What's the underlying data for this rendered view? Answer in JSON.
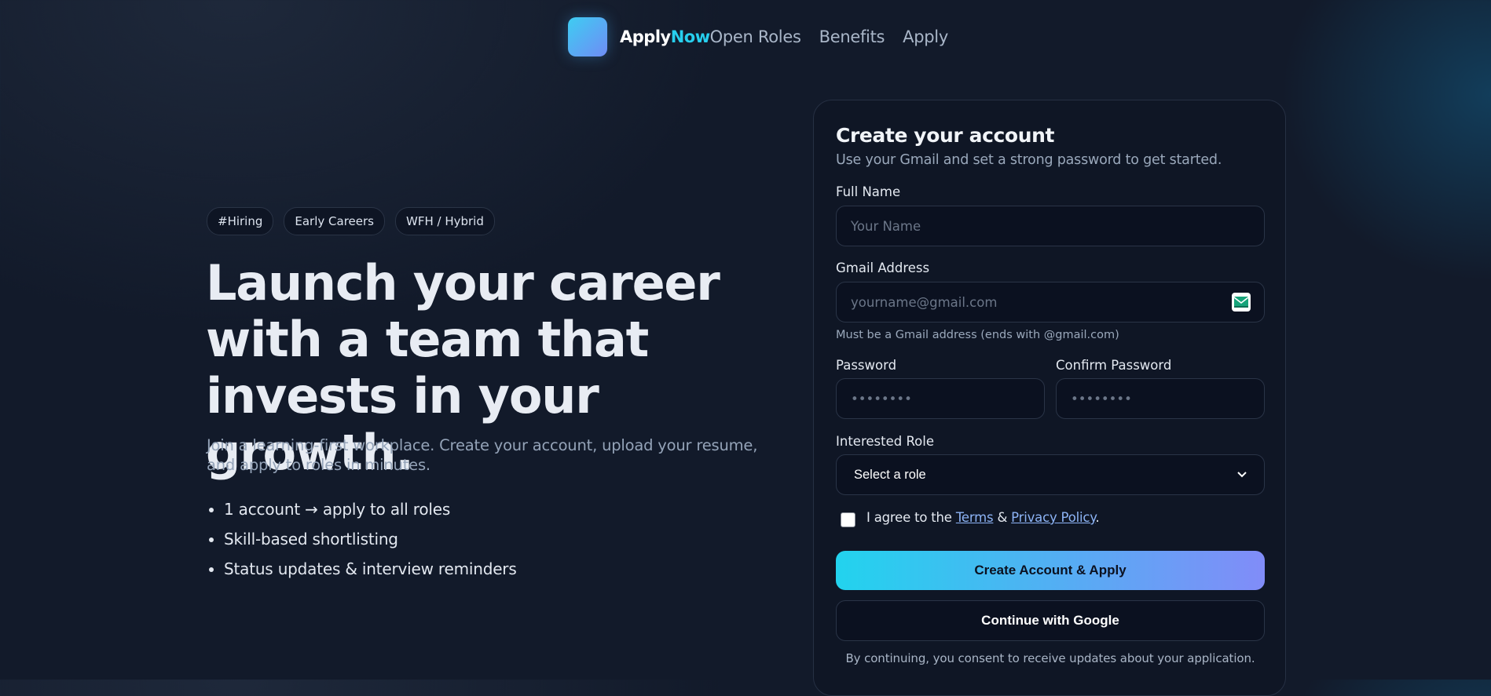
{
  "header": {
    "brand_part1": "Apply",
    "brand_part2": "Now",
    "nav": [
      "Open Roles",
      "Benefits",
      "Apply"
    ]
  },
  "hero": {
    "tags": [
      "#Hiring",
      "Early Careers",
      "WFH / Hybrid"
    ],
    "title": "Launch your career with a team that invests in your growth.",
    "subtitle": "Join a learning-first workplace. Create your account, upload your resume, and apply to roles in minutes.",
    "bullets": [
      "1 account → apply to all roles",
      "Skill-based shortlisting",
      "Status updates & interview reminders"
    ]
  },
  "form": {
    "title": "Create your account",
    "subtitle": "Use your Gmail and set a strong password to get started.",
    "full_name_label": "Full Name",
    "full_name_placeholder": "Your Name",
    "gmail_label": "Gmail Address",
    "gmail_placeholder": "yourname@gmail.com",
    "gmail_hint": "Must be a Gmail address (ends with @gmail.com)",
    "password_label": "Password",
    "password_placeholder": "••••••••",
    "confirm_label": "Confirm Password",
    "confirm_placeholder": "••••••••",
    "role_label": "Interested Role",
    "role_selected": "Select a role",
    "agree_prefix": "I agree to the ",
    "terms_link": "Terms",
    "agree_and": " & ",
    "privacy_link": "Privacy Policy",
    "agree_suffix": ".",
    "agree_checked": false,
    "primary_button": "Create Account & Apply",
    "google_button": "Continue with Google",
    "consent": "By continuing, you consent to receive updates about your application."
  },
  "icons": {
    "logo": "app-logo-gradient-square",
    "gmail": "envelope-icon",
    "select": "chevron-down-icon"
  },
  "colors": {
    "background": "#121a2a",
    "accent": "#27cfee",
    "gradient_start": "#22d3ee",
    "gradient_end": "#818cf8",
    "link": "#8db4f6"
  }
}
